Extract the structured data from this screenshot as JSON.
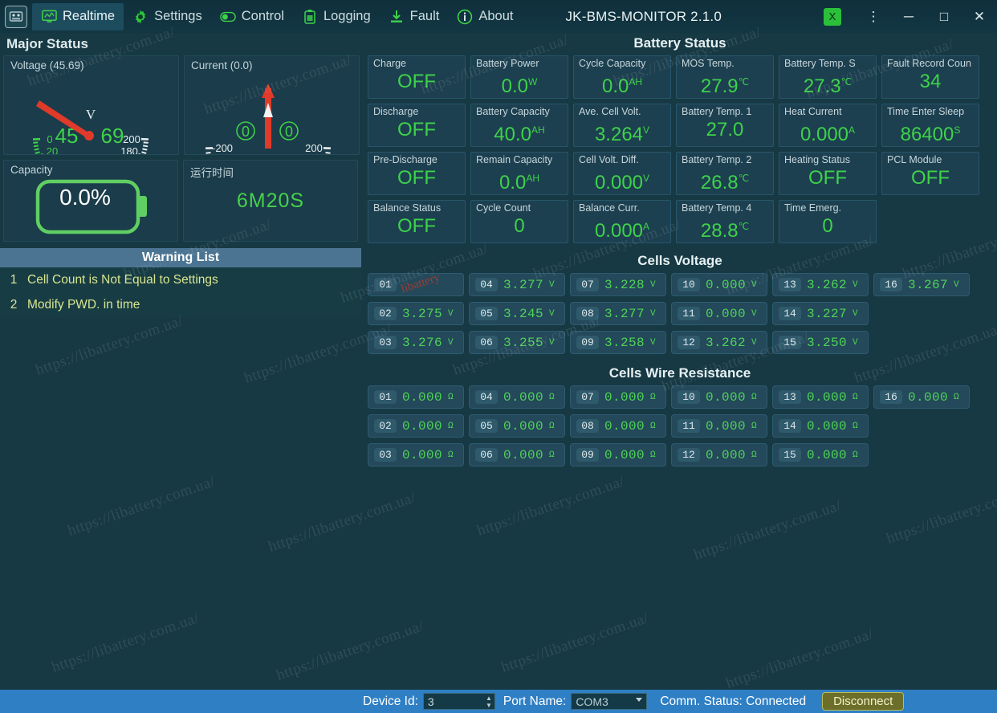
{
  "titlebar": {
    "app_icon": "bms-logo-icon",
    "tabs": [
      {
        "label": "Realtime",
        "icon": "monitor-icon",
        "active": true
      },
      {
        "label": "Settings",
        "icon": "gear-icon",
        "active": false
      },
      {
        "label": "Control",
        "icon": "toggle-icon",
        "active": false
      },
      {
        "label": "Logging",
        "icon": "clipboard-icon",
        "active": false
      },
      {
        "label": "Fault",
        "icon": "download-icon",
        "active": false
      },
      {
        "label": "About",
        "icon": "info-icon",
        "active": false
      }
    ],
    "title": "JK-BMS-MONITOR 2.1.0",
    "export_icon": "excel-export-icon",
    "menu_icon": "kebab-menu-icon",
    "minimize": "─",
    "maximize": "□",
    "close": "✕"
  },
  "left": {
    "section_title": "Major Status",
    "voltage": {
      "label": "Voltage (45.69)",
      "value": "45.69",
      "digits_left": "45",
      "digits_right": "69",
      "unit": "V",
      "ticks": [
        "0",
        "20",
        "40",
        "60",
        "80",
        "100",
        "120",
        "140",
        "160",
        "180",
        "200"
      ],
      "min": 0,
      "max": 200,
      "needle_value": 45.69
    },
    "current": {
      "label": "Current (0.0)",
      "value": "0.0",
      "digits_left": "0",
      "digits_right": "0",
      "ticks": [
        "-200",
        "-150",
        "-100",
        "-50",
        "0",
        "50",
        "100",
        "150",
        "200"
      ],
      "min": -200,
      "max": 200,
      "needle_value": 0
    },
    "capacity": {
      "label": "Capacity",
      "value": "0.0%"
    },
    "runtime": {
      "label": "运行时间",
      "value": "6M20S"
    },
    "warning": {
      "header": "Warning List",
      "items": [
        {
          "n": "1",
          "text": "Cell Count is Not Equal to Settings"
        },
        {
          "n": "2",
          "text": "Modify PWD. in time"
        }
      ]
    }
  },
  "battery_status": {
    "header": "Battery Status",
    "tiles": [
      {
        "label": "Charge",
        "value": "OFF",
        "unit": ""
      },
      {
        "label": "Battery Power",
        "value": "0.0",
        "unit": "W"
      },
      {
        "label": "Cycle Capacity",
        "value": "0.0",
        "unit": "AH"
      },
      {
        "label": "MOS Temp.",
        "value": "27.9",
        "unit": "℃"
      },
      {
        "label": "Battery Temp. S",
        "value": "27.3",
        "unit": "℃"
      },
      {
        "label": "Fault Record Coun",
        "value": "34",
        "unit": ""
      },
      {
        "label": "Discharge",
        "value": "OFF",
        "unit": ""
      },
      {
        "label": "Battery Capacity",
        "value": "40.0",
        "unit": "AH"
      },
      {
        "label": "Ave. Cell Volt.",
        "value": "3.264",
        "unit": "V"
      },
      {
        "label": "Battery Temp. 1",
        "value": "27.0",
        "unit": ""
      },
      {
        "label": "Heat Current",
        "value": "0.000",
        "unit": "A"
      },
      {
        "label": "Time Enter Sleep",
        "value": "86400",
        "unit": "S"
      },
      {
        "label": "Pre-Discharge",
        "value": "OFF",
        "unit": ""
      },
      {
        "label": "Remain Capacity",
        "value": "0.0",
        "unit": "AH"
      },
      {
        "label": "Cell Volt. Diff.",
        "value": "0.000",
        "unit": "V"
      },
      {
        "label": "Battery Temp. 2",
        "value": "26.8",
        "unit": "℃"
      },
      {
        "label": "Heating Status",
        "value": "OFF",
        "unit": ""
      },
      {
        "label": "PCL Module",
        "value": "OFF",
        "unit": ""
      },
      {
        "label": "Balance Status",
        "value": "OFF",
        "unit": ""
      },
      {
        "label": "Cycle Count",
        "value": "0",
        "unit": ""
      },
      {
        "label": "Balance Curr.",
        "value": "0.000",
        "unit": "A"
      },
      {
        "label": "Battery Temp. 4",
        "value": "28.8",
        "unit": "℃"
      },
      {
        "label": "Time Emerg.",
        "value": "0",
        "unit": ""
      }
    ]
  },
  "cells_voltage": {
    "header": "Cells Voltage",
    "unit": "V",
    "cells": [
      {
        "id": "01",
        "value": "",
        "masked": true
      },
      {
        "id": "04",
        "value": "3.277",
        "masked": false
      },
      {
        "id": "07",
        "value": "3.228",
        "masked": false
      },
      {
        "id": "10",
        "value": "0.000",
        "masked": false
      },
      {
        "id": "13",
        "value": "3.262",
        "masked": false
      },
      {
        "id": "16",
        "value": "3.267",
        "masked": false
      },
      {
        "id": "02",
        "value": "3.275",
        "masked": false
      },
      {
        "id": "05",
        "value": "3.245",
        "masked": false
      },
      {
        "id": "08",
        "value": "3.277",
        "masked": false
      },
      {
        "id": "11",
        "value": "0.000",
        "masked": false
      },
      {
        "id": "14",
        "value": "3.227",
        "masked": false
      },
      {
        "id": "",
        "value": "",
        "masked": false,
        "empty": true
      },
      {
        "id": "03",
        "value": "3.276",
        "masked": false
      },
      {
        "id": "06",
        "value": "3.255",
        "masked": false
      },
      {
        "id": "09",
        "value": "3.258",
        "masked": false
      },
      {
        "id": "12",
        "value": "3.262",
        "masked": false
      },
      {
        "id": "15",
        "value": "3.250",
        "masked": false
      },
      {
        "id": "",
        "value": "",
        "masked": false,
        "empty": true
      }
    ]
  },
  "cells_resistance": {
    "header": "Cells Wire Resistance",
    "unit": "Ω",
    "cells": [
      {
        "id": "01",
        "value": "0.000"
      },
      {
        "id": "04",
        "value": "0.000"
      },
      {
        "id": "07",
        "value": "0.000"
      },
      {
        "id": "10",
        "value": "0.000"
      },
      {
        "id": "13",
        "value": "0.000"
      },
      {
        "id": "16",
        "value": "0.000"
      },
      {
        "id": "02",
        "value": "0.000"
      },
      {
        "id": "05",
        "value": "0.000"
      },
      {
        "id": "08",
        "value": "0.000"
      },
      {
        "id": "11",
        "value": "0.000"
      },
      {
        "id": "14",
        "value": "0.000"
      },
      {
        "id": "",
        "value": "",
        "empty": true
      },
      {
        "id": "03",
        "value": "0.000"
      },
      {
        "id": "06",
        "value": "0.000"
      },
      {
        "id": "09",
        "value": "0.000"
      },
      {
        "id": "12",
        "value": "0.000"
      },
      {
        "id": "15",
        "value": "0.000"
      },
      {
        "id": "",
        "value": "",
        "empty": true
      }
    ]
  },
  "statusbar": {
    "device_id_label": "Device Id:",
    "device_id_value": "3",
    "port_label": "Port Name:",
    "port_value": "COM3",
    "comm_status": "Comm. Status: Connected",
    "disconnect_label": "Disconnect"
  },
  "watermarks": [
    "https://libattery.com.ua/",
    "https://libattery.com.ua/",
    "https://libattery.com.ua/",
    "https://libattery.com.ua/",
    "https://libattery.com.ua/",
    "https://libattery.com.ua/",
    "https://libattery.com.ua/",
    "https://libattery.com.ua/",
    "https://libattery.com.ua/",
    "https://libattery.com.ua/",
    "https://libattery.com.ua/",
    "https://libattery.com.ua/",
    "https://libattery.com.ua/",
    "https://libattery.com.ua/",
    "https://libattery.com.ua/",
    "https://libattery.com.ua/",
    "https://libattery.com.ua/",
    "https://libattery.com.ua/",
    "https://libattery.com.ua/",
    "https://libattery.com.ua/",
    "https://libattery.com.ua/",
    "https://libattery.com.ua/",
    "https://libattery.com.ua/",
    "https://libattery.com.ua/"
  ],
  "colors": {
    "background": "#173944",
    "panel": "#1b3c4a",
    "tile": "#1d4050",
    "value_green": "#3ed24a",
    "accent_blue": "#2f7fc4",
    "warning_header": "#4a7491",
    "needle_red": "#e03a2a"
  }
}
